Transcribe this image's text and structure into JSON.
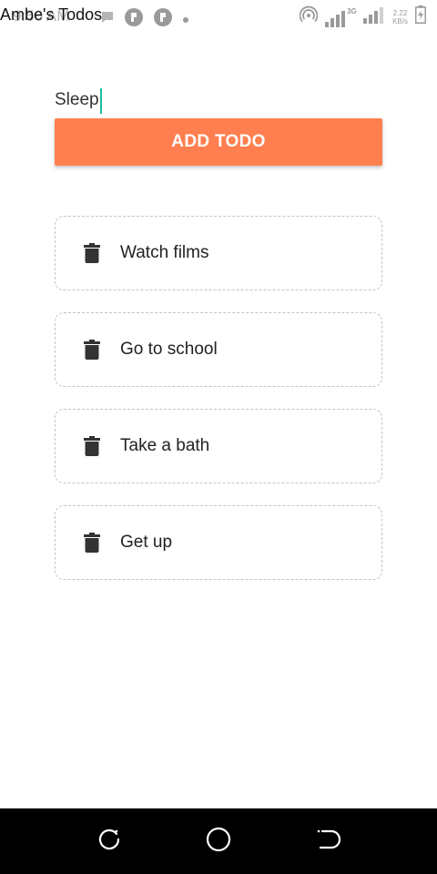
{
  "status_bar": {
    "time": "9:56 AM",
    "network_type": "3G",
    "net_speed_value": "2.22",
    "net_speed_unit": "KB/s"
  },
  "app": {
    "title": "Ambe's Todos"
  },
  "input": {
    "value": "Sleep"
  },
  "add_button": {
    "label": "ADD TODO"
  },
  "todos": [
    {
      "text": "Watch films"
    },
    {
      "text": "Go to school"
    },
    {
      "text": "Take a bath"
    },
    {
      "text": "Get up"
    }
  ],
  "colors": {
    "accent": "#ff7f50",
    "caret": "#1abc9c",
    "nav_bar": "#000000"
  },
  "icons": {
    "todo_item": "trash-icon",
    "nav_left": "recent-apps-icon",
    "nav_center": "home-icon",
    "nav_right": "back-icon"
  }
}
